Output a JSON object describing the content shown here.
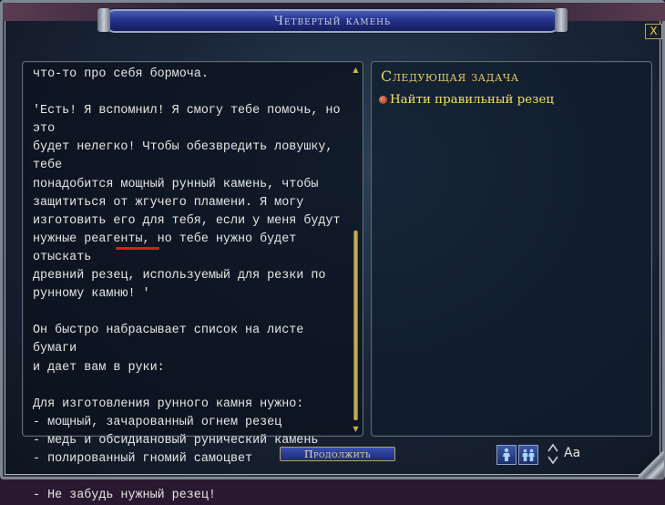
{
  "window": {
    "title": "Четвертый камень",
    "close_label": "X"
  },
  "story": {
    "text": "что-то про себя бормоча.\n\n'Есть! Я вспомнил! Я смогу тебе помочь, но это\nбудет нелегко! Чтобы обезвредить ловушку, тебе\nпонадобится мощный рунный камень, чтобы\nзащититься от жгучего пламени. Я могу\nизготовить его для тебя, если у меня будут\nнужные реагенты, но тебе нужно будет отыскать\nдревний резец, используемый для резки по\nрунному камню! '\n\nОн быстро набрасывает список на листе бумаги\nи дает вам в руки:\n\nДля изготовления рунного камня нужно:\n- мощный, зачарованный огнем резец\n- медь и обсидиановый рунический камень\n- полированный гномий самоцвет\n\n- Не забудь нужный резец!"
  },
  "quest": {
    "heading": "Следующая задача",
    "next_task": "Найти правильный резец"
  },
  "controls": {
    "continue_label": "Продолжить",
    "font_size_label": "Aa"
  },
  "annotation_color": "#d62020"
}
